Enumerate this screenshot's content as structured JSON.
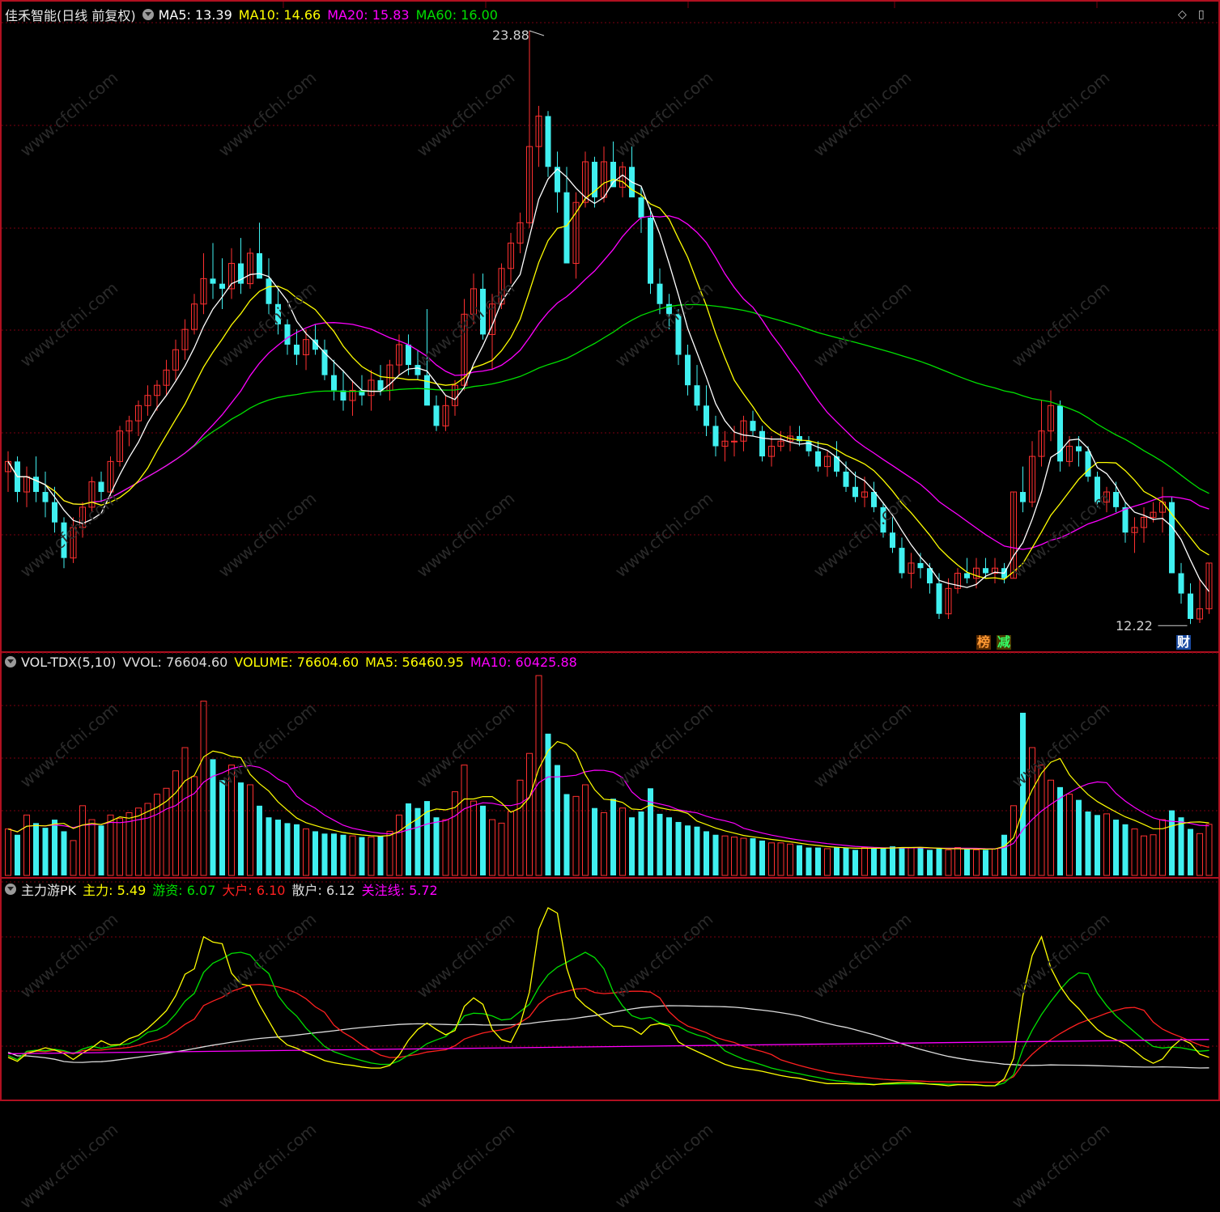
{
  "main_panel": {
    "title": "佳禾智能(日线 前复权)",
    "ma": [
      {
        "label": "MA5: 13.39",
        "color": "#ffffff"
      },
      {
        "label": "MA10: 14.66",
        "color": "#ffff00"
      },
      {
        "label": "MA20: 15.83",
        "color": "#ff00ff"
      },
      {
        "label": "MA60: 16.00",
        "color": "#00e000"
      }
    ],
    "high_label": "23.88",
    "low_label": "12.22",
    "badges": [
      {
        "text": "榜",
        "color": "#ff9933",
        "bg": "#5a2a00"
      },
      {
        "text": "减",
        "color": "#33ff66",
        "bg": "#4a3a00"
      },
      {
        "text": "财",
        "color": "#ffffff",
        "bg": "#1a4aa0"
      }
    ]
  },
  "volume_panel": {
    "title": "VOL-TDX(5,10)",
    "items": [
      {
        "label": "VVOL: 76604.60",
        "color": "#dddddd"
      },
      {
        "label": "VOLUME: 76604.60",
        "color": "#ffff00"
      },
      {
        "label": "MA5: 56460.95",
        "color": "#ffff00"
      },
      {
        "label": "MA10: 60425.88",
        "color": "#ff00ff"
      }
    ]
  },
  "indicator_panel": {
    "title": "主力游PK",
    "items": [
      {
        "label": "主力: 5.49",
        "color": "#ffff00"
      },
      {
        "label": "游资: 6.07",
        "color": "#00e000"
      },
      {
        "label": "大户: 6.10",
        "color": "#ff2020"
      },
      {
        "label": "散户: 6.12",
        "color": "#dddddd"
      },
      {
        "label": "关注线: 5.72",
        "color": "#ff00ff"
      }
    ]
  },
  "watermark": "www.cfchi.com",
  "colors": {
    "up": "#ff3030",
    "down": "#40f0f0",
    "grid": "#7a0010",
    "border": "#b01020"
  },
  "chart_data": {
    "type": "candlestick",
    "price_range": [
      12.22,
      23.88
    ],
    "candles": [
      [
        15.2,
        15.6,
        14.8,
        15.4
      ],
      [
        15.4,
        15.5,
        14.6,
        14.8
      ],
      [
        14.8,
        15.3,
        14.5,
        15.1
      ],
      [
        15.1,
        15.5,
        14.6,
        14.8
      ],
      [
        14.8,
        15.2,
        14.3,
        14.6
      ],
      [
        14.6,
        14.9,
        14.0,
        14.2
      ],
      [
        14.2,
        14.3,
        13.3,
        13.5
      ],
      [
        13.5,
        14.3,
        13.4,
        14.1
      ],
      [
        14.1,
        14.6,
        13.9,
        14.5
      ],
      [
        14.5,
        15.1,
        14.4,
        15.0
      ],
      [
        15.0,
        15.2,
        14.6,
        14.8
      ],
      [
        14.8,
        15.5,
        14.7,
        15.4
      ],
      [
        15.4,
        16.1,
        15.3,
        16.0
      ],
      [
        16.0,
        16.3,
        15.7,
        16.2
      ],
      [
        16.2,
        16.6,
        15.9,
        16.5
      ],
      [
        16.5,
        16.9,
        16.3,
        16.7
      ],
      [
        16.7,
        17.0,
        16.4,
        16.9
      ],
      [
        16.9,
        17.4,
        16.7,
        17.2
      ],
      [
        17.2,
        17.8,
        17.0,
        17.6
      ],
      [
        17.6,
        18.2,
        17.4,
        18.0
      ],
      [
        18.0,
        18.7,
        17.9,
        18.5
      ],
      [
        18.5,
        19.5,
        18.3,
        19.0
      ],
      [
        19.0,
        19.7,
        18.6,
        18.9
      ],
      [
        18.9,
        19.4,
        18.4,
        18.8
      ],
      [
        18.8,
        19.6,
        18.6,
        19.3
      ],
      [
        19.3,
        19.8,
        18.7,
        18.9
      ],
      [
        18.9,
        19.6,
        18.8,
        19.5
      ],
      [
        19.5,
        20.1,
        19.3,
        19.0
      ],
      [
        19.0,
        19.4,
        18.3,
        18.5
      ],
      [
        18.5,
        18.8,
        17.9,
        18.1
      ],
      [
        18.1,
        18.2,
        17.5,
        17.7
      ],
      [
        17.7,
        18.0,
        17.3,
        17.5
      ],
      [
        17.5,
        18.0,
        17.2,
        17.8
      ],
      [
        17.8,
        18.1,
        17.5,
        17.6
      ],
      [
        17.6,
        17.8,
        17.0,
        17.1
      ],
      [
        17.1,
        17.4,
        16.6,
        16.8
      ],
      [
        16.8,
        17.2,
        16.4,
        16.6
      ],
      [
        16.6,
        17.0,
        16.3,
        16.8
      ],
      [
        16.8,
        17.1,
        16.5,
        16.7
      ],
      [
        16.7,
        17.2,
        16.4,
        17.0
      ],
      [
        17.0,
        17.3,
        16.7,
        16.8
      ],
      [
        16.8,
        17.4,
        16.6,
        17.3
      ],
      [
        17.3,
        17.9,
        17.1,
        17.7
      ],
      [
        17.7,
        17.9,
        17.1,
        17.3
      ],
      [
        17.3,
        17.6,
        17.0,
        17.1
      ],
      [
        17.1,
        18.4,
        16.8,
        16.5
      ],
      [
        16.5,
        16.7,
        16.0,
        16.1
      ],
      [
        16.1,
        16.7,
        16.0,
        16.5
      ],
      [
        16.5,
        17.0,
        16.3,
        16.9
      ],
      [
        16.9,
        18.6,
        16.8,
        18.3
      ],
      [
        18.3,
        19.1,
        18.1,
        18.8
      ],
      [
        18.8,
        19.1,
        17.8,
        17.9
      ],
      [
        17.9,
        18.7,
        17.2,
        18.5
      ],
      [
        18.5,
        19.3,
        18.4,
        19.2
      ],
      [
        19.2,
        19.9,
        18.9,
        19.7
      ],
      [
        19.7,
        20.3,
        19.5,
        20.1
      ],
      [
        20.1,
        23.88,
        20.0,
        21.6
      ],
      [
        21.6,
        22.4,
        21.2,
        22.2
      ],
      [
        22.2,
        22.3,
        21.0,
        21.2
      ],
      [
        21.2,
        21.5,
        20.3,
        20.7
      ],
      [
        20.7,
        21.2,
        20.3,
        19.3
      ],
      [
        19.3,
        20.7,
        19.0,
        20.5
      ],
      [
        20.5,
        21.5,
        20.4,
        21.3
      ],
      [
        21.3,
        21.4,
        20.4,
        20.6
      ],
      [
        20.6,
        21.6,
        20.5,
        21.3
      ],
      [
        21.3,
        21.7,
        20.9,
        20.8
      ],
      [
        20.8,
        21.3,
        20.6,
        21.2
      ],
      [
        21.2,
        21.6,
        20.7,
        20.6
      ],
      [
        20.6,
        20.8,
        19.9,
        20.2
      ],
      [
        20.2,
        20.4,
        18.7,
        18.9
      ],
      [
        18.9,
        19.2,
        18.3,
        18.5
      ],
      [
        18.5,
        18.7,
        18.0,
        18.3
      ],
      [
        18.3,
        18.4,
        17.3,
        17.5
      ],
      [
        17.5,
        17.7,
        16.7,
        16.9
      ],
      [
        16.9,
        17.3,
        16.4,
        16.5
      ],
      [
        16.5,
        16.9,
        15.9,
        16.1
      ],
      [
        16.1,
        16.3,
        15.5,
        15.7
      ],
      [
        15.7,
        16.0,
        15.4,
        15.8
      ],
      [
        15.8,
        16.1,
        15.5,
        15.8
      ],
      [
        15.8,
        16.3,
        15.6,
        16.2
      ],
      [
        16.2,
        16.4,
        15.9,
        16.0
      ],
      [
        16.0,
        16.1,
        15.4,
        15.5
      ],
      [
        15.5,
        15.9,
        15.3,
        15.7
      ],
      [
        15.7,
        16.0,
        15.6,
        15.8
      ],
      [
        15.8,
        16.1,
        15.6,
        15.9
      ],
      [
        15.9,
        16.1,
        15.7,
        15.8
      ],
      [
        15.8,
        15.9,
        15.5,
        15.6
      ],
      [
        15.6,
        15.8,
        15.2,
        15.3
      ],
      [
        15.3,
        15.6,
        15.1,
        15.5
      ],
      [
        15.5,
        15.8,
        15.1,
        15.2
      ],
      [
        15.2,
        15.4,
        14.8,
        14.9
      ],
      [
        14.9,
        15.2,
        14.6,
        14.7
      ],
      [
        14.7,
        15.1,
        14.5,
        14.8
      ],
      [
        14.8,
        15.0,
        14.4,
        14.5
      ],
      [
        14.5,
        14.6,
        13.9,
        14.0
      ],
      [
        14.0,
        14.3,
        13.6,
        13.7
      ],
      [
        13.7,
        13.9,
        13.1,
        13.2
      ],
      [
        13.2,
        13.6,
        12.9,
        13.4
      ],
      [
        13.4,
        13.6,
        13.1,
        13.3
      ],
      [
        13.3,
        13.4,
        12.8,
        13.0
      ],
      [
        13.0,
        13.2,
        12.3,
        12.4
      ],
      [
        12.4,
        13.1,
        12.3,
        12.9
      ],
      [
        12.9,
        13.3,
        12.8,
        13.2
      ],
      [
        13.2,
        13.5,
        13.0,
        13.1
      ],
      [
        13.1,
        13.5,
        12.9,
        13.3
      ],
      [
        13.3,
        13.5,
        13.1,
        13.2
      ],
      [
        13.2,
        13.5,
        13.0,
        13.3
      ],
      [
        13.3,
        13.4,
        13.0,
        13.1
      ],
      [
        13.1,
        14.8,
        13.1,
        14.8
      ],
      [
        14.8,
        15.3,
        14.4,
        14.6
      ],
      [
        14.6,
        15.8,
        14.5,
        15.5
      ],
      [
        15.5,
        16.6,
        15.3,
        16.0
      ],
      [
        16.0,
        16.8,
        15.8,
        16.5
      ],
      [
        16.5,
        16.6,
        15.2,
        15.4
      ],
      [
        15.4,
        15.9,
        15.3,
        15.7
      ],
      [
        15.7,
        15.9,
        15.3,
        15.6
      ],
      [
        15.6,
        15.7,
        15.0,
        15.1
      ],
      [
        15.1,
        15.2,
        14.5,
        14.6
      ],
      [
        14.6,
        14.9,
        14.4,
        14.8
      ],
      [
        14.8,
        15.0,
        14.4,
        14.5
      ],
      [
        14.5,
        14.6,
        13.8,
        14.0
      ],
      [
        14.0,
        14.3,
        13.6,
        14.1
      ],
      [
        14.1,
        14.5,
        13.8,
        14.3
      ],
      [
        14.3,
        14.6,
        14.2,
        14.4
      ],
      [
        14.4,
        14.9,
        14.0,
        14.6
      ],
      [
        14.6,
        14.7,
        13.2,
        13.2
      ],
      [
        13.2,
        13.4,
        12.6,
        12.8
      ],
      [
        12.8,
        13.0,
        12.2,
        12.3
      ],
      [
        12.3,
        13.1,
        12.22,
        12.5
      ],
      [
        12.5,
        13.4,
        12.4,
        13.4
      ]
    ],
    "volume": [
      40,
      35,
      52,
      45,
      41,
      48,
      38,
      30,
      60,
      48,
      43,
      52,
      49,
      54,
      58,
      62,
      70,
      75,
      90,
      110,
      85,
      150,
      100,
      82,
      95,
      80,
      78,
      60,
      50,
      48,
      45,
      44,
      40,
      38,
      36,
      36,
      35,
      34,
      33,
      33,
      34,
      38,
      52,
      62,
      58,
      64,
      50,
      48,
      72,
      95,
      64,
      60,
      48,
      45,
      55,
      82,
      105,
      172,
      122,
      95,
      70,
      68,
      78,
      58,
      54,
      66,
      58,
      50,
      55,
      75,
      53,
      50,
      46,
      43,
      42,
      38,
      35,
      34,
      33,
      32,
      32,
      30,
      28,
      28,
      27,
      26,
      24,
      24,
      23,
      24,
      24,
      22,
      24,
      23,
      24,
      25,
      24,
      24,
      24,
      22,
      23,
      22,
      24,
      23,
      22,
      22,
      23,
      35,
      60,
      140,
      110,
      95,
      82,
      76,
      70,
      65,
      55,
      52,
      53,
      48,
      44,
      40,
      34,
      35,
      48,
      56,
      50,
      40,
      36,
      44
    ]
  }
}
